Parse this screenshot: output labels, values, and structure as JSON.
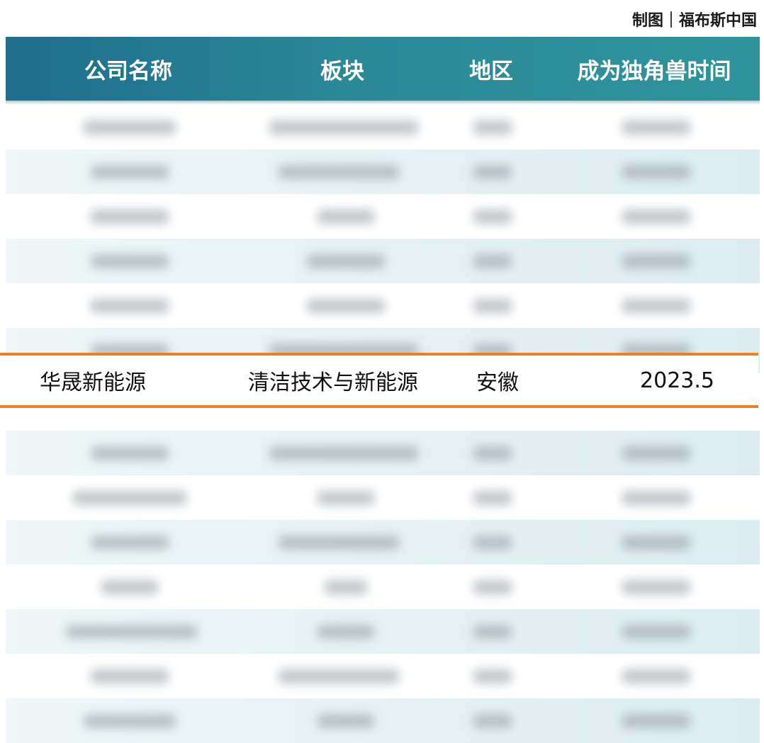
{
  "credit": "制图｜福布斯中国",
  "table": {
    "headers": [
      "公司名称",
      "板块",
      "地区",
      "成为独角兽时间"
    ],
    "highlight_row": [
      "华晟新能源",
      "清洁技术与新能源",
      "安徽",
      "2023.5"
    ]
  },
  "colors": {
    "header_start": "#1e6e8c",
    "header_end": "#2f949c",
    "highlight_border": "#ee7f22"
  }
}
